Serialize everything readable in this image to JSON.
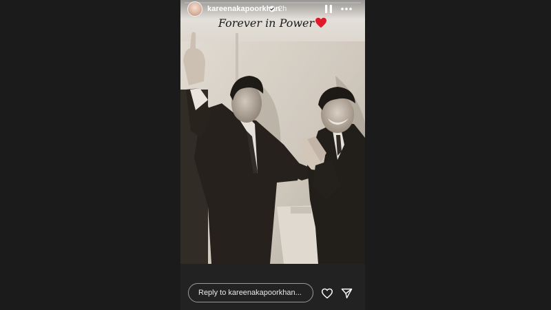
{
  "story": {
    "username": "kareenakapoorkhan",
    "time_ago": "2h",
    "caption": "Forever in Power",
    "caption_emoji": "❤️",
    "progress": 1.0,
    "verified": true
  },
  "icons": {
    "verified": "verified-badge-icon",
    "pause": "pause-icon",
    "more": "more-options-icon",
    "like": "heart-icon",
    "share": "send-icon"
  },
  "reply": {
    "placeholder": "Reply to kareenakapoorkhan..."
  },
  "colors": {
    "background": "#1b1b1b",
    "footer": "#222222",
    "heart": "#e0192b",
    "verified": "#3897f0"
  }
}
